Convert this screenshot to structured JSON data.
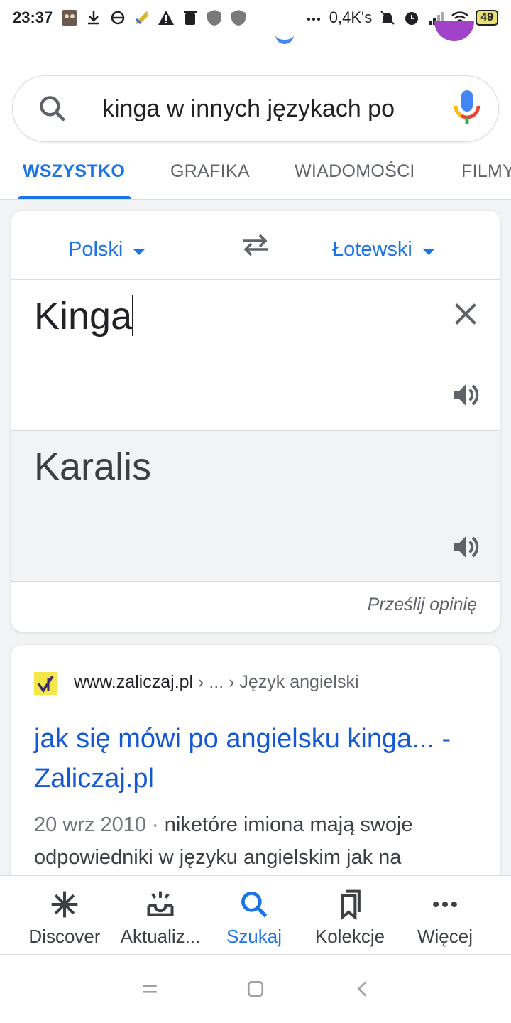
{
  "status_bar": {
    "time": "23:37",
    "net_speed": "0,4K's",
    "battery": "49",
    "icons": [
      "photo-icon",
      "download-icon",
      "sync-icon",
      "app-icon",
      "warning-icon",
      "trash-icon",
      "shield-icon",
      "shield-icon",
      "more-dots-icon",
      "mute-icon",
      "alarm-icon",
      "signal-icon",
      "wifi-icon",
      "battery-icon"
    ]
  },
  "search": {
    "query": "kinga w innych językach po"
  },
  "tabs": [
    {
      "label": "WSZYSTKO",
      "active": true
    },
    {
      "label": "GRAFIKA"
    },
    {
      "label": "WIADOMOŚCI"
    },
    {
      "label": "FILMY"
    }
  ],
  "translate": {
    "source_lang": "Polski",
    "target_lang": "Łotewski",
    "source_text": "Kinga",
    "target_text": "Karalis",
    "feedback": "Prześlij opinię"
  },
  "result": {
    "domain": "www.zaliczaj.pl",
    "path": " › ... › Język angielski",
    "title": "jak się mówi po angielsku kinga... - Zaliczaj.pl",
    "date": "20 wrz 2010 · ",
    "snippet": "niketóre imiona mają swoje odpowiedniki w języku angielskim jak na"
  },
  "bottom_nav": [
    {
      "label": "Discover",
      "icon": "asterisk-icon"
    },
    {
      "label": "Aktualiz...",
      "icon": "updates-tray-icon"
    },
    {
      "label": "Szukaj",
      "icon": "search-icon",
      "active": true
    },
    {
      "label": "Kolekcje",
      "icon": "bookmarks-icon"
    },
    {
      "label": "Więcej",
      "icon": "more-icon"
    }
  ],
  "colors": {
    "accent": "#1a73e8",
    "link": "#1558d6",
    "card_alt_bg": "#f1f3f4"
  }
}
